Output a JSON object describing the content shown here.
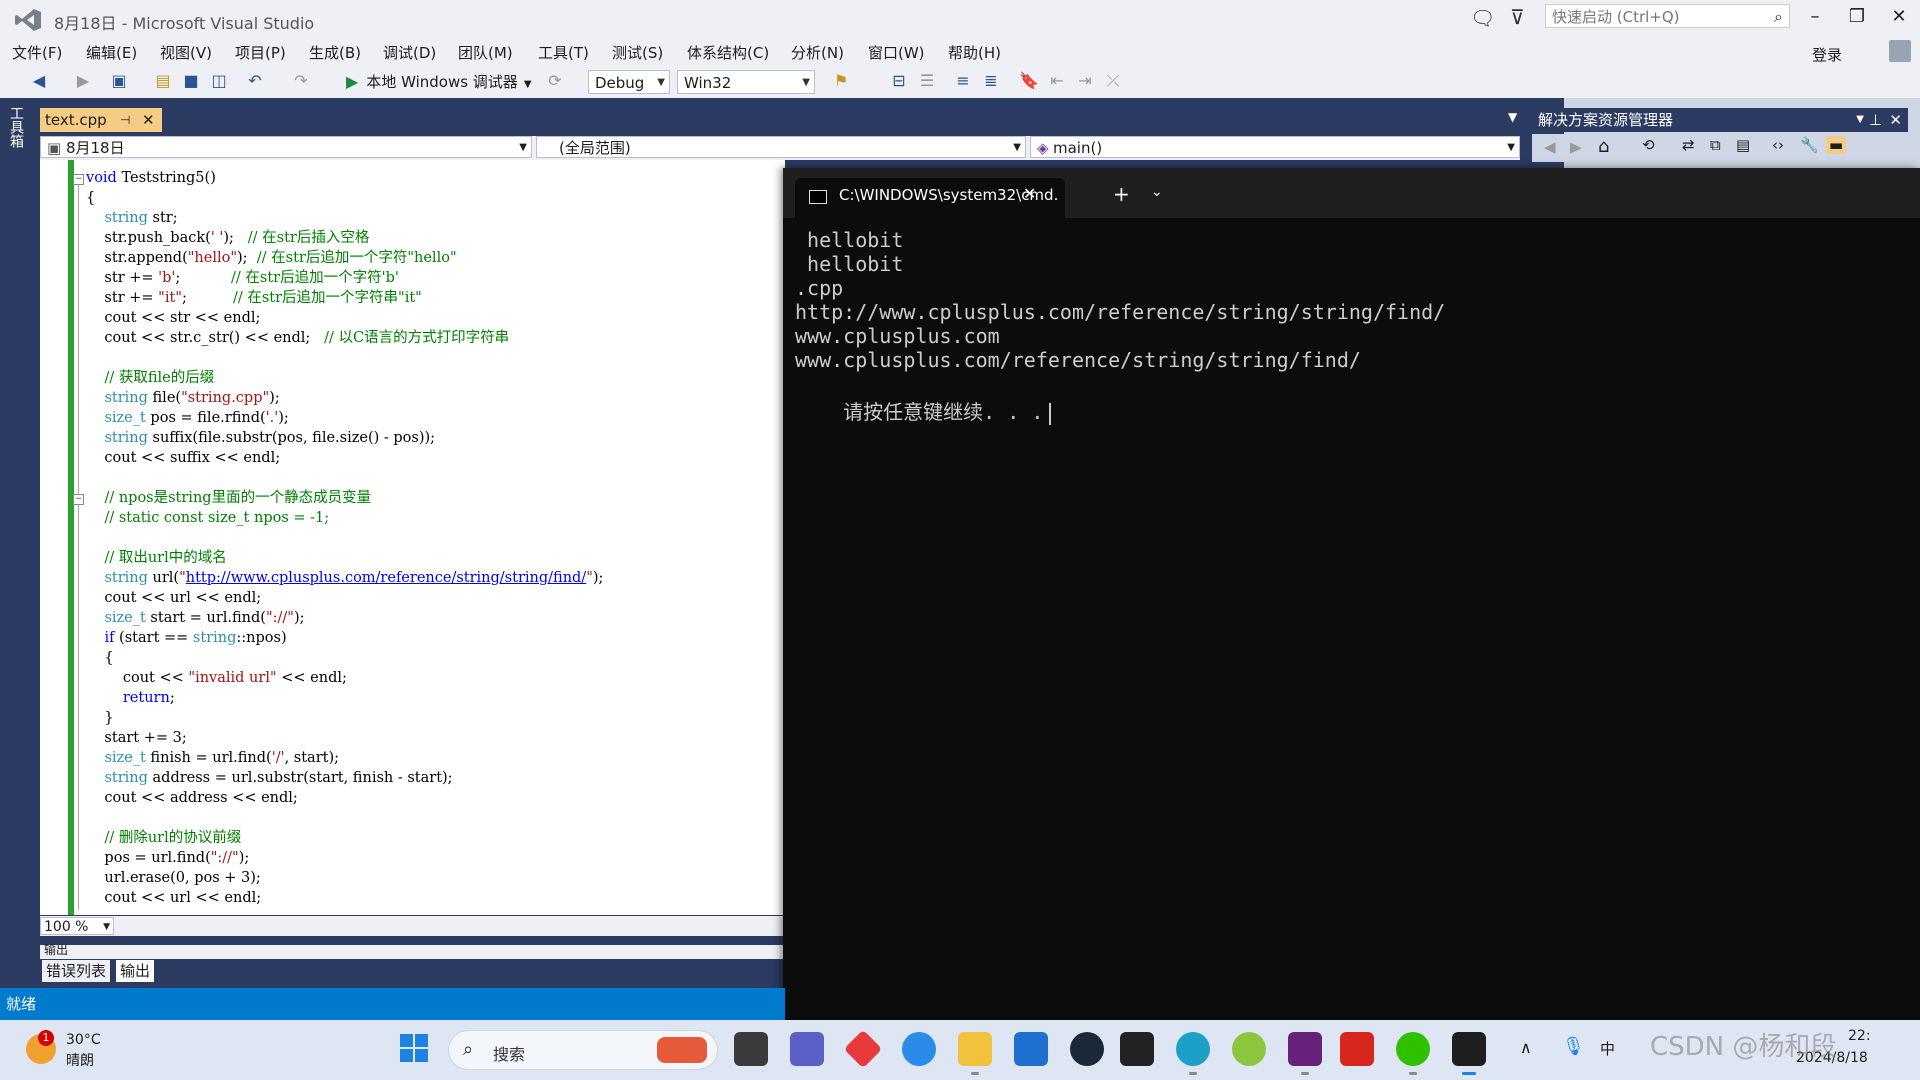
{
  "window": {
    "title": "8月18日 - Microsoft Visual Studio",
    "quick_launch_placeholder": "快速启动 (Ctrl+Q)",
    "login": "登录"
  },
  "menu": [
    "文件(F)",
    "编辑(E)",
    "视图(V)",
    "项目(P)",
    "生成(B)",
    "调试(D)",
    "团队(M)",
    "工具(T)",
    "测试(S)",
    "体系结构(C)",
    "分析(N)",
    "窗口(W)",
    "帮助(H)"
  ],
  "toolbar": {
    "run_label": "本地 Windows 调试器",
    "config": "Debug",
    "platform": "Win32"
  },
  "toolbox_label": "工具箱",
  "editor": {
    "tab_name": "text.cpp",
    "nav_project": "8月18日",
    "nav_scope": "(全局范围)",
    "nav_member": "main()",
    "zoom": "100 %",
    "output_label": "输出"
  },
  "code_lines": [
    {
      "segments": [
        {
          "t": "void",
          "c": "kw"
        },
        {
          "t": " Teststring5()",
          "c": ""
        }
      ]
    },
    {
      "segments": [
        {
          "t": "{",
          "c": ""
        }
      ]
    },
    {
      "segments": [
        {
          "t": "    ",
          "c": ""
        },
        {
          "t": "string",
          "c": "ty"
        },
        {
          "t": " str;",
          "c": ""
        }
      ]
    },
    {
      "segments": [
        {
          "t": "    str.push_back(",
          "c": ""
        },
        {
          "t": "' '",
          "c": "str"
        },
        {
          "t": ");   ",
          "c": ""
        },
        {
          "t": "// 在str后插入空格",
          "c": "cm"
        }
      ]
    },
    {
      "segments": [
        {
          "t": "    str.append(",
          "c": ""
        },
        {
          "t": "\"hello\"",
          "c": "str"
        },
        {
          "t": ");  ",
          "c": ""
        },
        {
          "t": "// 在str后追加一个字符\"hello\"",
          "c": "cm"
        }
      ]
    },
    {
      "segments": [
        {
          "t": "    str += ",
          "c": ""
        },
        {
          "t": "'b'",
          "c": "str"
        },
        {
          "t": ";           ",
          "c": ""
        },
        {
          "t": "// 在str后追加一个字符'b'",
          "c": "cm"
        }
      ]
    },
    {
      "segments": [
        {
          "t": "    str += ",
          "c": ""
        },
        {
          "t": "\"it\"",
          "c": "str"
        },
        {
          "t": ";          ",
          "c": ""
        },
        {
          "t": "// 在str后追加一个字符串\"it\"",
          "c": "cm"
        }
      ]
    },
    {
      "segments": [
        {
          "t": "    cout << str << endl;",
          "c": ""
        }
      ]
    },
    {
      "segments": [
        {
          "t": "    cout << str.c_str() << endl;   ",
          "c": ""
        },
        {
          "t": "// 以C语言的方式打印字符串",
          "c": "cm"
        }
      ]
    },
    {
      "segments": [
        {
          "t": "",
          "c": ""
        }
      ]
    },
    {
      "segments": [
        {
          "t": "    ",
          "c": ""
        },
        {
          "t": "// 获取file的后缀",
          "c": "cm"
        }
      ]
    },
    {
      "segments": [
        {
          "t": "    ",
          "c": ""
        },
        {
          "t": "string",
          "c": "ty"
        },
        {
          "t": " file(",
          "c": ""
        },
        {
          "t": "\"string.cpp\"",
          "c": "str"
        },
        {
          "t": ");",
          "c": ""
        }
      ]
    },
    {
      "segments": [
        {
          "t": "    ",
          "c": ""
        },
        {
          "t": "size_t",
          "c": "ty"
        },
        {
          "t": " pos = file.rfind(",
          "c": ""
        },
        {
          "t": "'.'",
          "c": "str"
        },
        {
          "t": ");",
          "c": ""
        }
      ]
    },
    {
      "segments": [
        {
          "t": "    ",
          "c": ""
        },
        {
          "t": "string",
          "c": "ty"
        },
        {
          "t": " suffix(file.substr(pos, file.size() - pos));",
          "c": ""
        }
      ]
    },
    {
      "segments": [
        {
          "t": "    cout << suffix << endl;",
          "c": ""
        }
      ]
    },
    {
      "segments": [
        {
          "t": "",
          "c": ""
        }
      ]
    },
    {
      "segments": [
        {
          "t": "    ",
          "c": ""
        },
        {
          "t": "// npos是string里面的一个静态成员变量",
          "c": "cm"
        }
      ]
    },
    {
      "segments": [
        {
          "t": "    ",
          "c": ""
        },
        {
          "t": "// static const size_t npos = -1;",
          "c": "cm"
        }
      ]
    },
    {
      "segments": [
        {
          "t": "",
          "c": ""
        }
      ]
    },
    {
      "segments": [
        {
          "t": "    ",
          "c": ""
        },
        {
          "t": "// 取出url中的域名",
          "c": "cm"
        }
      ]
    },
    {
      "segments": [
        {
          "t": "    ",
          "c": ""
        },
        {
          "t": "string",
          "c": "ty"
        },
        {
          "t": " url(",
          "c": ""
        },
        {
          "t": "\"",
          "c": "str"
        },
        {
          "t": "http://www.cplusplus.com/reference/string/string/find/",
          "c": "url"
        },
        {
          "t": "\"",
          "c": "str"
        },
        {
          "t": ");",
          "c": ""
        }
      ]
    },
    {
      "segments": [
        {
          "t": "    cout << url << endl;",
          "c": ""
        }
      ]
    },
    {
      "segments": [
        {
          "t": "    ",
          "c": ""
        },
        {
          "t": "size_t",
          "c": "ty"
        },
        {
          "t": " start = url.find(",
          "c": ""
        },
        {
          "t": "\"://\"",
          "c": "str"
        },
        {
          "t": ");",
          "c": ""
        }
      ]
    },
    {
      "segments": [
        {
          "t": "    ",
          "c": ""
        },
        {
          "t": "if",
          "c": "kw"
        },
        {
          "t": " (start == ",
          "c": ""
        },
        {
          "t": "string",
          "c": "ty"
        },
        {
          "t": "::npos)",
          "c": ""
        }
      ]
    },
    {
      "segments": [
        {
          "t": "    {",
          "c": ""
        }
      ]
    },
    {
      "segments": [
        {
          "t": "        cout << ",
          "c": ""
        },
        {
          "t": "\"invalid url\"",
          "c": "str"
        },
        {
          "t": " << endl;",
          "c": ""
        }
      ]
    },
    {
      "segments": [
        {
          "t": "        ",
          "c": ""
        },
        {
          "t": "return",
          "c": "kw"
        },
        {
          "t": ";",
          "c": ""
        }
      ]
    },
    {
      "segments": [
        {
          "t": "    }",
          "c": ""
        }
      ]
    },
    {
      "segments": [
        {
          "t": "    start += 3;",
          "c": ""
        }
      ]
    },
    {
      "segments": [
        {
          "t": "    ",
          "c": ""
        },
        {
          "t": "size_t",
          "c": "ty"
        },
        {
          "t": " finish = url.find(",
          "c": ""
        },
        {
          "t": "'/'",
          "c": "str"
        },
        {
          "t": ", start);",
          "c": ""
        }
      ]
    },
    {
      "segments": [
        {
          "t": "    ",
          "c": ""
        },
        {
          "t": "string",
          "c": "ty"
        },
        {
          "t": " address = url.substr(start, finish - start);",
          "c": ""
        }
      ]
    },
    {
      "segments": [
        {
          "t": "    cout << address << endl;",
          "c": ""
        }
      ]
    },
    {
      "segments": [
        {
          "t": "",
          "c": ""
        }
      ]
    },
    {
      "segments": [
        {
          "t": "    ",
          "c": ""
        },
        {
          "t": "// 删除url的协议前缀",
          "c": "cm"
        }
      ]
    },
    {
      "segments": [
        {
          "t": "    pos = url.find(",
          "c": ""
        },
        {
          "t": "\"://\"",
          "c": "str"
        },
        {
          "t": ");",
          "c": ""
        }
      ]
    },
    {
      "segments": [
        {
          "t": "    url.erase(0, pos + 3);",
          "c": ""
        }
      ]
    },
    {
      "segments": [
        {
          "t": "    cout << url << endl;",
          "c": ""
        }
      ]
    }
  ],
  "bottom_tabs": {
    "error_list": "错误列表",
    "output": "输出"
  },
  "solution_explorer": {
    "title": "解决方案资源管理器"
  },
  "cmd": {
    "tab_title": "C:\\WINDOWS\\system32\\cmd.",
    "lines": [
      " hellobit",
      " hellobit",
      ".cpp",
      "http://www.cplusplus.com/reference/string/string/find/",
      "www.cplusplus.com",
      "www.cplusplus.com/reference/string/string/find/"
    ],
    "prompt": "请按任意键继续. . ."
  },
  "status": {
    "text": "就绪"
  },
  "taskbar": {
    "weather_temp": "30°C",
    "weather_desc": "晴朗",
    "weather_badge": "1",
    "search_label": "搜索",
    "time": "22:",
    "date": "2024/8/18",
    "watermark": "CSDN @杨和段"
  },
  "colors": {
    "status_bar": "#007acc",
    "active_tab": "#f5cc84",
    "cmd_background": "#0c0c0c",
    "frame": "#2b3b62"
  }
}
